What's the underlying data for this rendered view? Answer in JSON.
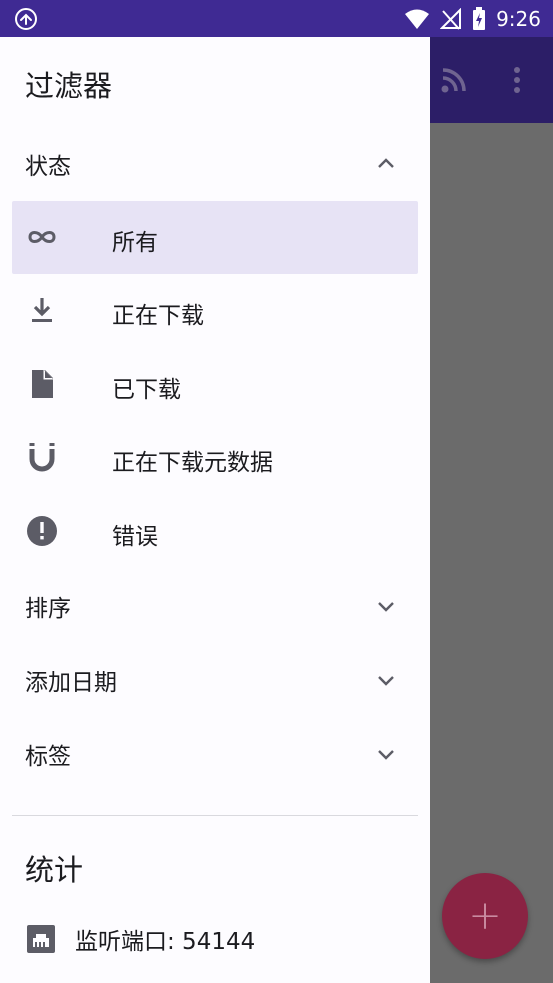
{
  "status_bar": {
    "time": "9:26",
    "icons": [
      "app-logo-icon",
      "wifi-icon",
      "no-signal-icon",
      "battery-charging-icon"
    ]
  },
  "background_app": {
    "toolbar_icons": [
      "rss-icon",
      "more-vert-icon"
    ],
    "fab_icon": "add-icon",
    "fab_symbol": "+"
  },
  "drawer": {
    "title": "过滤器",
    "status_section": {
      "label": "状态",
      "expanded": true,
      "items": [
        {
          "label": "所有",
          "icon": "infinity-icon",
          "selected": true
        },
        {
          "label": "正在下载",
          "icon": "download-icon",
          "selected": false
        },
        {
          "label": "已下载",
          "icon": "file-icon",
          "selected": false
        },
        {
          "label": "正在下载元数据",
          "icon": "magnet-icon",
          "selected": false
        },
        {
          "label": "错误",
          "icon": "error-icon",
          "selected": false
        }
      ]
    },
    "sort_section": {
      "label": "排序",
      "expanded": false
    },
    "date_section": {
      "label": "添加日期",
      "expanded": false
    },
    "tags_section": {
      "label": "标签",
      "expanded": false
    },
    "stats": {
      "title": "统计",
      "port_label": "监听端口: 54144"
    }
  },
  "colors": {
    "status_bar": "#3f2a93",
    "selected_item": "#e7e3f5",
    "icon": "#5c5c66",
    "fab": "#8a2343"
  }
}
